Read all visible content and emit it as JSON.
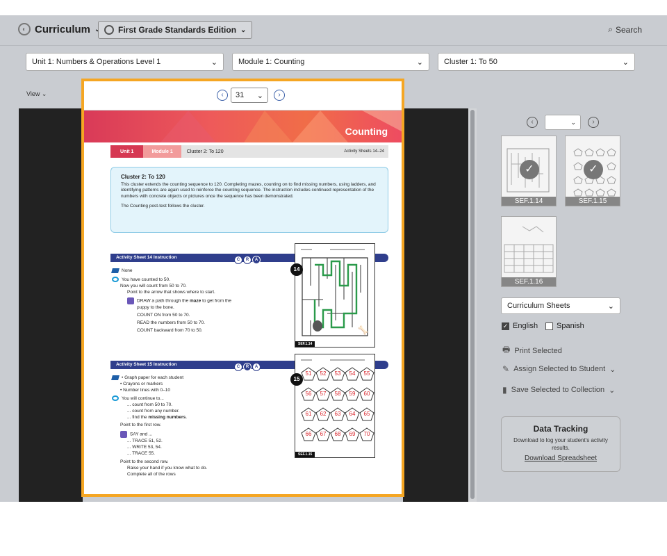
{
  "header": {
    "app_title": "Curriculum",
    "edition": "First Grade Standards Edition",
    "search_label": "Search"
  },
  "filters": {
    "unit": "Unit 1: Numbers & Operations Level 1",
    "module": "Module 1: Counting",
    "cluster": "Cluster 1: To 50"
  },
  "view_label": "View",
  "viewer": {
    "page": "31",
    "banner_title": "Counting",
    "crumb_unit": "Unit 1",
    "crumb_module": "Module 1",
    "crumb_cluster": "Cluster 2: To 120",
    "crumb_activity": "Activity Sheets 14–24",
    "cluster_title": "Cluster 2: To 120",
    "cluster_text": "This cluster extends the counting sequence to 120. Completing mazes, counting on to find missing numbers, using ladders, and identifying patterns are again used to reinforce the counting sequence. The instruction includes continued representation of the numbers with concrete objects or pictures once the sequence has been demonstrated.",
    "cluster_text2": "The Counting post-test follows the cluster.",
    "act14_title": "Activity Sheet 14 Instruction",
    "act14": {
      "materials": "None",
      "l1": "You have counted to 50.",
      "l2": "Now you will count from 50 to 70.",
      "l3": "Point to the arrow that shows where to start.",
      "l4a": "DRAW a path through the ",
      "l4b": "maze",
      "l4c": " to get from the",
      "l5": "puppy to the bone.",
      "l6": "COUNT ON from 50 to 70.",
      "l7": "READ the numbers from 50 to 70.",
      "l8": "COUNT backward from 70 to 50."
    },
    "act15_title": "Activity Sheet 15 Instruction",
    "act15": {
      "m1": "• Graph paper for each student",
      "m2": "• Crayons or markers",
      "m3": "• Number lines with 0–10",
      "l1": "You will continue to...",
      "l2": "... count from 50 to 70.",
      "l3": "... count from any number.",
      "l4a": "... find the ",
      "l4b": "missing numbers",
      "l4c": ".",
      "l5": "Point to the first row.",
      "l6": "SAY and ...",
      "l7": "... TRACE 51, 52.",
      "l8": "... WRITE 53, 54.",
      "l9": "... TRACE 55.",
      "l10": "Point to the second row.",
      "l11": "Raise your hand if you know what to do.",
      "l12": "Complete all of the rows"
    },
    "cra": [
      "C",
      "R",
      "A"
    ],
    "sheet14_num": "14",
    "sheet14_tag": "SEF.1.14",
    "sheet15_num": "15",
    "sheet15_tag": "SEF.1.15",
    "pentagon_rows": [
      [
        "51",
        "52",
        "53",
        "54",
        "55"
      ],
      [
        "56",
        "57",
        "58",
        "59",
        "60"
      ],
      [
        "61",
        "62",
        "63",
        "64",
        "65"
      ],
      [
        "66",
        "67",
        "68",
        "69",
        "70"
      ]
    ]
  },
  "sidebar": {
    "thumbs": [
      {
        "label": "SEF.1.14",
        "checked": true
      },
      {
        "label": "SEF.1.15",
        "checked": true
      },
      {
        "label": "SEF.1.16",
        "checked": false
      }
    ],
    "sheet_type": "Curriculum Sheets",
    "english_label": "English",
    "spanish_label": "Spanish",
    "print_label": "Print Selected",
    "assign_label": "Assign Selected to Student",
    "save_label": "Save Selected to Collection",
    "dt_title": "Data Tracking",
    "dt_text": "Download to log your student's activity results.",
    "dt_link": "Download Spreadsheet"
  }
}
